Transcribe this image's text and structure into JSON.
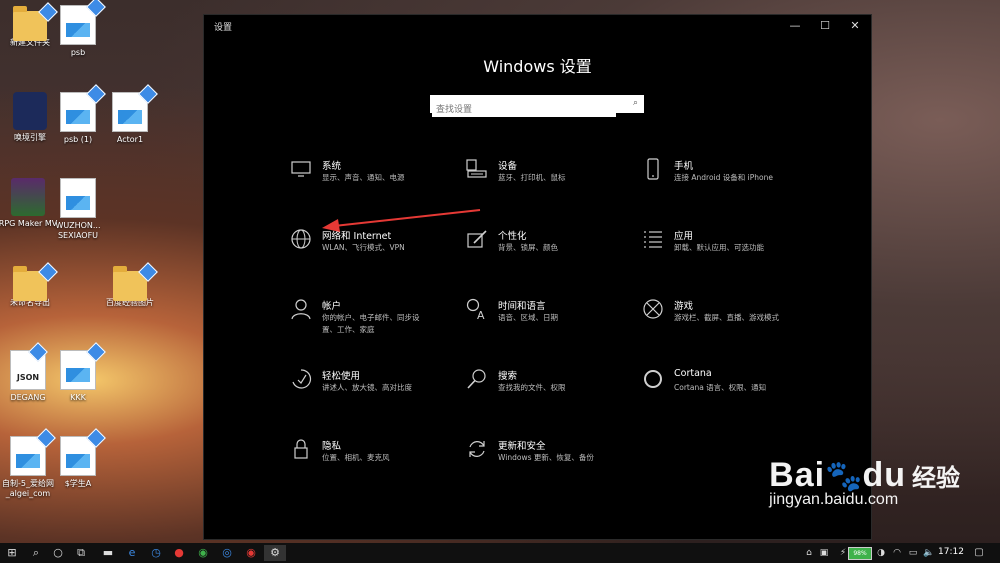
{
  "desktop": {
    "icons": [
      {
        "label": "新建文件夹",
        "type": "folder"
      },
      {
        "label": "psb",
        "type": "image"
      },
      {
        "label": "唤境引擎",
        "type": "app"
      },
      {
        "label": "psb (1)",
        "type": "image"
      },
      {
        "label": "Actor1",
        "type": "image"
      },
      {
        "label": "RPG Maker MV",
        "type": "rpg"
      },
      {
        "label": "WUZHON... SEXIAOFU",
        "type": "image"
      },
      {
        "label": "未命名导出",
        "type": "folder"
      },
      {
        "label": "百度经验图片",
        "type": "folder"
      },
      {
        "label": "DEGANG",
        "type": "json"
      },
      {
        "label": "KKK",
        "type": "image"
      },
      {
        "label": "自制-5_爱给网_algei_com",
        "type": "image"
      },
      {
        "label": "$学生A",
        "type": "image"
      }
    ]
  },
  "window": {
    "title": "设置",
    "heading": "Windows 设置",
    "search_placeholder": "查找设置",
    "controls": {
      "minimize": "—",
      "maximize": "☐",
      "close": "✕"
    },
    "tiles": [
      {
        "name": "系统",
        "desc": "显示、声音、通知、电源",
        "icon": "monitor-icon"
      },
      {
        "name": "设备",
        "desc": "蓝牙、打印机、鼠标",
        "icon": "keyboard-icon"
      },
      {
        "name": "手机",
        "desc": "连接 Android 设备和 iPhone",
        "icon": "phone-icon"
      },
      {
        "name": "网络和 Internet",
        "desc": "WLAN、飞行模式、VPN",
        "icon": "globe-icon"
      },
      {
        "name": "个性化",
        "desc": "背景、锁屏、颜色",
        "icon": "brush-icon"
      },
      {
        "name": "应用",
        "desc": "卸载、默认应用、可选功能",
        "icon": "apps-list-icon"
      },
      {
        "name": "帐户",
        "desc": "你的帐户、电子邮件、同步设置、工作、家庭",
        "icon": "person-icon"
      },
      {
        "name": "时间和语言",
        "desc": "语音、区域、日期",
        "icon": "time-language-icon"
      },
      {
        "name": "游戏",
        "desc": "游戏栏、截屏、直播、游戏模式",
        "icon": "xbox-icon"
      },
      {
        "name": "轻松使用",
        "desc": "讲述人、放大镜、高对比度",
        "icon": "ease-of-access-icon"
      },
      {
        "name": "搜索",
        "desc": "查找我的文件、权限",
        "icon": "search-icon"
      },
      {
        "name": "Cortana",
        "desc": "Cortana 语言、权限、通知",
        "icon": "cortana-icon"
      },
      {
        "name": "隐私",
        "desc": "位置、相机、麦克风",
        "icon": "lock-icon"
      },
      {
        "name": "更新和安全",
        "desc": "Windows 更新、恢复、备份",
        "icon": "update-icon"
      }
    ]
  },
  "taskbar": {
    "battery": "98%",
    "time": "17:12"
  },
  "watermark": {
    "brand": "Bai",
    "brand2": "du",
    "cn": "经验",
    "url": "jingyan.baidu.com"
  },
  "colors": {
    "accent": "#e53935",
    "window_bg": "#000000",
    "battery": "#3fb24b"
  }
}
